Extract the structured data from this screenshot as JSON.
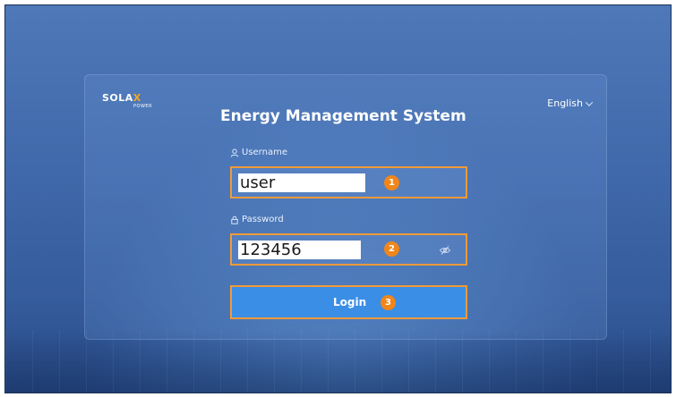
{
  "branding": {
    "logo_main": "SOLA",
    "logo_accent": "X",
    "logo_sub": "POWER"
  },
  "header": {
    "title": "Energy Management System",
    "language": "English"
  },
  "form": {
    "username_label": "Username",
    "username_value": "user",
    "password_label": "Password",
    "password_value": "123456",
    "login_label": "Login"
  },
  "annotations": {
    "step1": "1",
    "step2": "2",
    "step3": "3",
    "highlight_color": "#f29a38",
    "badge_color": "#f0861a"
  },
  "colors": {
    "background": "#3f68aa",
    "login_button": "#3a8ee6",
    "logo_accent": "#f5a623"
  },
  "icons": {
    "username": "user-icon",
    "password": "lock-icon",
    "visibility": "eye-off-icon",
    "language": "chevron-down-icon"
  }
}
